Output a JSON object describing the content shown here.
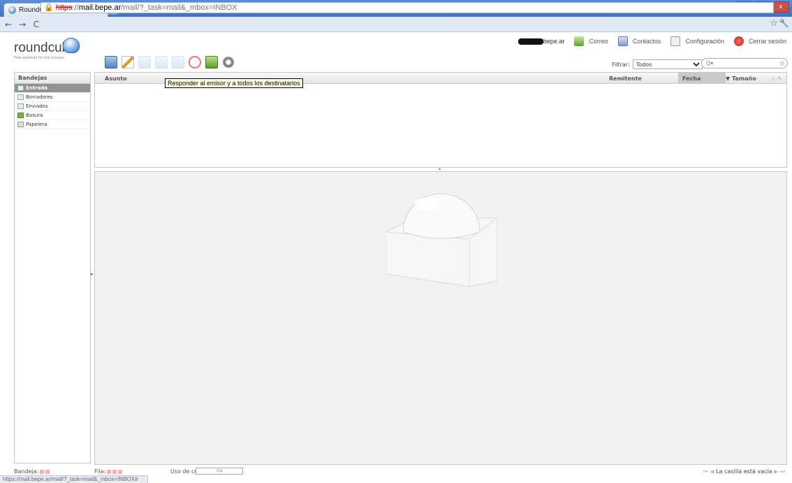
{
  "browser": {
    "tab_title": "RoundCube Webmail...",
    "tab_close": "×",
    "url_scheme": "https",
    "url_host": "mail.bepe.ar",
    "url_path": "/mail/?_task=mail&_mbox=INBOX",
    "status_url": "https://mail.bepe.ar/mail/?_task=mail&_mbox=INBOX#"
  },
  "app": {
    "logo": "roundcube",
    "tagline": "Free webmail for the masses"
  },
  "header": {
    "username_suffix": "bepe.ar",
    "correo": "Correo",
    "contactos": "Contactos",
    "configuracion": "Configuración",
    "cerrar": "Cerrar sesión"
  },
  "filter": {
    "label": "Filtrar:",
    "value": "Todos",
    "search_placeholder": "Q▾"
  },
  "folders": {
    "title": "Bandejas",
    "items": [
      {
        "label": "Entrada",
        "selected": true
      },
      {
        "label": "Borradores"
      },
      {
        "label": "Enviados"
      },
      {
        "label": "Basura"
      },
      {
        "label": "Papelera"
      }
    ]
  },
  "list": {
    "col_subject": "Asunto",
    "col_from": "Remitente",
    "col_date": "Fecha",
    "col_size": "Tamaño"
  },
  "tooltip": "Responder al emisor y a todos los destinatarios",
  "footer": {
    "bandeja": "Bandeja:",
    "fila": "Fila:",
    "uso": "Uso de cuenta:",
    "quota": "n/a",
    "empty": "La casilla está vacía"
  },
  "colors": {
    "accent": "#3f73c4",
    "selected_folder": "#929292",
    "tooltip_bg": "#ffffe1"
  }
}
